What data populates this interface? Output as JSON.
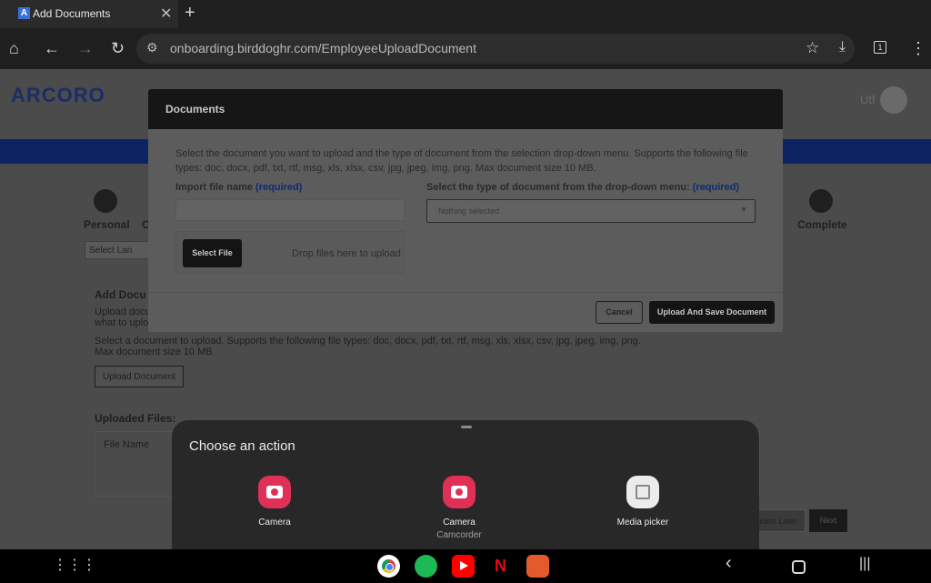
{
  "browser": {
    "tab_title": "Add Documents",
    "favicon": "A",
    "url": "onboarding.birddoghr.com/EmployeeUploadDocument",
    "tab_count": "1"
  },
  "page": {
    "logo": "ARCORO",
    "user_name": "Utf",
    "steps": [
      "Personal",
      "C",
      "Complete"
    ],
    "language": "Select Lan",
    "section_title": "Add Docu",
    "section_text1": "Upload docu",
    "section_text2": "what to uplo",
    "supported_text1": "Select a document to upload. Supports the following file types: doc, docx, pdf, txt, rtf, msg, xls, xlsx, csv, jpg, jpeg, img, png.",
    "supported_text2": "Max document size 10 MB.",
    "upload_button": "Upload Document",
    "uploaded_files": "Uploaded Files:",
    "file_name_col": "File Name",
    "finish_later": "inish Later",
    "next": "Next"
  },
  "modal": {
    "title": "Documents",
    "description": "Select the document you want to upload and the type of document from the selection drop-down menu. Supports the following file types: doc, docx, pdf, txt, rtf, msg, xls, xlsx, csv, jpg, jpeg, img, png. Max document size 10 MB.",
    "import_label": "Import file name",
    "type_label": "Select the type of document from the drop-down menu:",
    "required": "(required)",
    "select_placeholder": "Nothing selected",
    "select_file": "Select File",
    "drop_text": "Drop files here to upload",
    "cancel": "Cancel",
    "upload_save": "Upload And Save Document"
  },
  "sheet": {
    "title": "Choose an action",
    "apps": [
      {
        "label": "Camera",
        "sub": ""
      },
      {
        "label": "Camera",
        "sub": "Camcorder"
      },
      {
        "label": "Media picker",
        "sub": ""
      }
    ]
  }
}
